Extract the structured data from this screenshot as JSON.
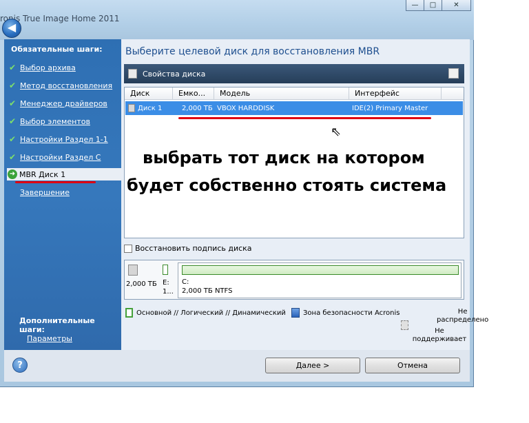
{
  "window": {
    "title": "ronis True Image Home 2011",
    "back_glyph": "◀",
    "controls": {
      "minimize": "—",
      "maximize": "□",
      "close": "✕"
    }
  },
  "sidebar": {
    "header": "Обязательные шаги:",
    "steps": [
      {
        "label": "Выбор архива",
        "state": "done"
      },
      {
        "label": "Метод восстановления",
        "state": "done"
      },
      {
        "label": "Менеджер драйверов",
        "state": "done"
      },
      {
        "label": "Выбор элементов",
        "state": "done"
      },
      {
        "label": "Настройки Раздел 1-1",
        "state": "done"
      },
      {
        "label": "Настройки Раздел C",
        "state": "done"
      },
      {
        "label": "MBR Диск 1",
        "state": "current"
      },
      {
        "label": "Завершение",
        "state": "pending"
      }
    ],
    "optional_header": "Дополнительные шаги:",
    "optional_link": "Параметры",
    "check_glyph": "✔",
    "arrow_glyph": "➜"
  },
  "main": {
    "title": "Выберите целевой диск для восстановления MBR",
    "props_bar_label": "Свойства диска",
    "columns": [
      "Диск",
      "Емко...",
      "Модель",
      "Интерфейс"
    ],
    "rows": [
      {
        "disk": "Диск 1",
        "capacity": "2,000 ТБ",
        "model": "VBOX HARDDISK",
        "interface": "IDE(2) Primary Master"
      }
    ],
    "annotation_line1": "выбрать тот диск на котором",
    "annotation_line2": "будет собственно стоять система",
    "restore_signature_label": "Восстановить подпись диска",
    "diskmap": {
      "size": "2,000 ТБ",
      "e_label": "E:",
      "e_sub": "1...",
      "c_label": "C:",
      "c_sub": "2,000 ТБ  NTFS"
    },
    "legend": {
      "primary": "Основной // Логический // Динамический",
      "acronis": "Зона безопасности Acronis",
      "unallocated_1": "Не",
      "unallocated_2": "распределено",
      "unsupported_1": "Не",
      "unsupported_2": "поддерживает"
    }
  },
  "buttons": {
    "help": "?",
    "next": "Далее >",
    "cancel": "Отмена"
  },
  "colors": {
    "sidebar_bg": "#3173b8",
    "selected_row": "#3b8de6",
    "annotation_underline": "#e00010"
  }
}
